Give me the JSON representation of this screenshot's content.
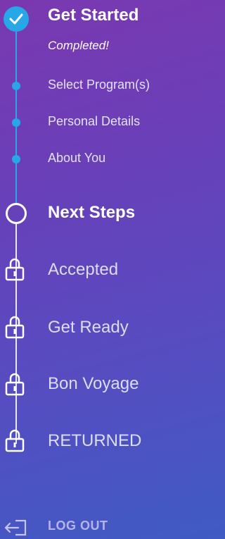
{
  "steps": {
    "get_started": {
      "title": "Get Started",
      "status": "Completed!"
    },
    "sub_steps": [
      "Select Program(s)",
      "Personal Details",
      "About You"
    ],
    "next_steps": "Next Steps",
    "locked": [
      "Accepted",
      "Get Ready",
      "Bon Voyage",
      "RETURNED"
    ]
  },
  "logout_label": "LOG OUT",
  "colors": {
    "accent": "#27a7e8",
    "bg_top": "#7a38b0",
    "bg_bottom": "#3f5bc4"
  },
  "icons": [
    "check-icon",
    "circle-icon",
    "lock-icon",
    "logout-icon"
  ]
}
